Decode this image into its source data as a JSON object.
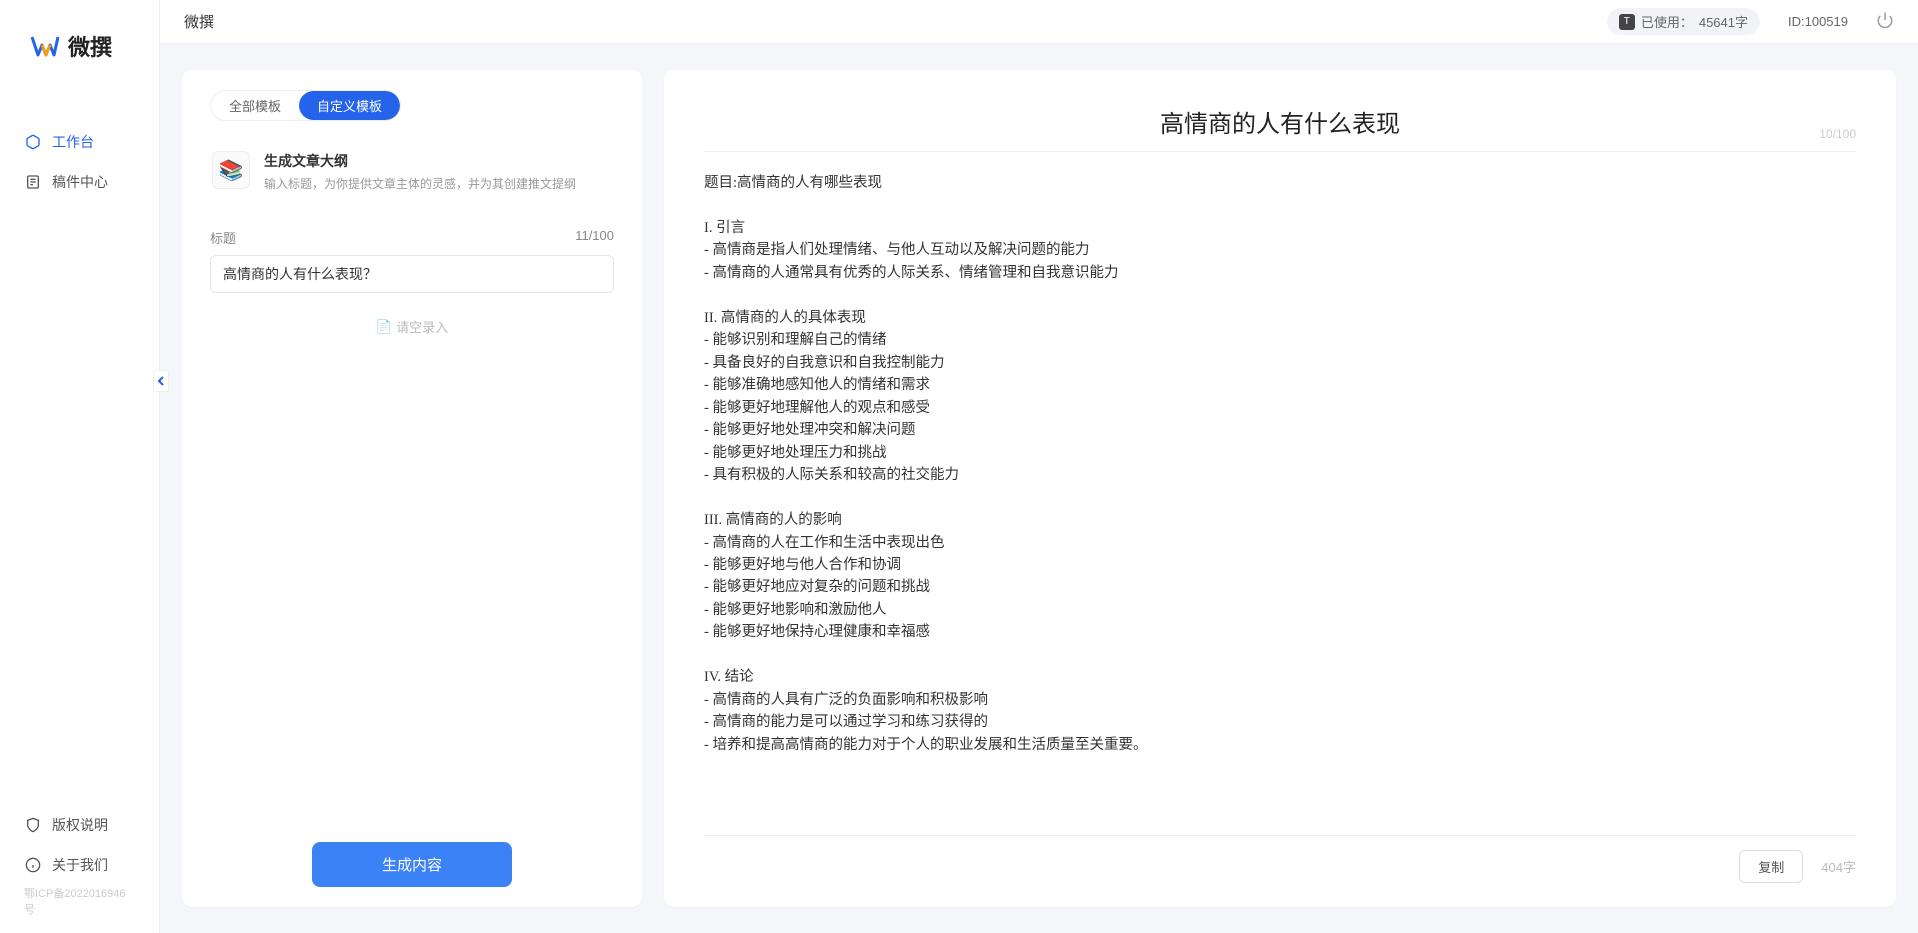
{
  "app_name": "微撰",
  "logo_text": "微撰",
  "topbar": {
    "usage_prefix": "已使用：",
    "usage_value": "45641字",
    "id_label": "ID:100519"
  },
  "sidebar": {
    "nav": [
      {
        "label": "工作台",
        "icon": "cube-icon"
      },
      {
        "label": "稿件中心",
        "icon": "doc-icon"
      }
    ],
    "bottom": [
      {
        "label": "版权说明",
        "icon": "shield-icon"
      },
      {
        "label": "关于我们",
        "icon": "info-icon"
      }
    ],
    "icp": "鄂ICP备2022016946号"
  },
  "left": {
    "tabs": [
      "全部模板",
      "自定义模板"
    ],
    "active_tab": 1,
    "template": {
      "title": "生成文章大纲",
      "desc": "输入标题，为你提供文章主体的灵感，并为其创建推文提纲"
    },
    "field_label": "标题",
    "char_counter": "11/100",
    "input_value": "高情商的人有什么表现？",
    "empty_hint": "请空录入",
    "generate_btn": "生成内容"
  },
  "right": {
    "title": "高情商的人有什么表现",
    "title_counter": "10/100",
    "copy_btn": "复制",
    "word_count": "404字",
    "body": "题目:高情商的人有哪些表现\n\nI. 引言\n- 高情商是指人们处理情绪、与他人互动以及解决问题的能力\n- 高情商的人通常具有优秀的人际关系、情绪管理和自我意识能力\n\nII. 高情商的人的具体表现\n- 能够识别和理解自己的情绪\n- 具备良好的自我意识和自我控制能力\n- 能够准确地感知他人的情绪和需求\n- 能够更好地理解他人的观点和感受\n- 能够更好地处理冲突和解决问题\n- 能够更好地处理压力和挑战\n- 具有积极的人际关系和较高的社交能力\n\nIII. 高情商的人的影响\n- 高情商的人在工作和生活中表现出色\n- 能够更好地与他人合作和协调\n- 能够更好地应对复杂的问题和挑战\n- 能够更好地影响和激励他人\n- 能够更好地保持心理健康和幸福感\n\nIV. 结论\n- 高情商的人具有广泛的负面影响和积极影响\n- 高情商的能力是可以通过学习和练习获得的\n- 培养和提高高情商的能力对于个人的职业发展和生活质量至关重要。"
  }
}
